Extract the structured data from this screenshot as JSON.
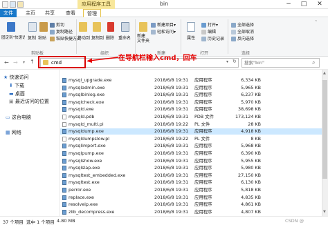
{
  "window": {
    "title": "bin",
    "contextual_tab": "应用程序工具",
    "controls": [
      "−",
      "□",
      "✕"
    ]
  },
  "tabs": [
    {
      "label": "文件"
    },
    {
      "label": "主页"
    },
    {
      "label": "共享"
    },
    {
      "label": "查看"
    },
    {
      "label": "管理"
    }
  ],
  "ribbon": {
    "clipboard": {
      "pin": "固定到\"快速访问\"",
      "copy": "复制",
      "paste": "粘贴",
      "cut": "剪切",
      "copy_path": "复制路径",
      "paste_shortcut": "粘贴快捷方式",
      "label": "剪贴板"
    },
    "organize": {
      "move_to": "移动到",
      "copy_to": "复制到",
      "delete": "删除",
      "rename": "重命名",
      "label": "组织"
    },
    "new": {
      "new_folder": "新建\n文件夹",
      "new_item": "新建项目▾",
      "easy_access": "轻松访问▾",
      "label": "新建"
    },
    "open": {
      "properties": "属性",
      "open": "打开▾",
      "edit": "编辑",
      "history": "历史记录",
      "label": "打开"
    },
    "select": {
      "select_all": "全部选择",
      "select_none": "全部取消",
      "invert": "反向选择",
      "label": "选择"
    }
  },
  "addressbar": {
    "value": "cmd",
    "search_placeholder": "搜索\"bin\"",
    "annotation": "在导航栏输入cmd，回车"
  },
  "navpane": {
    "items": [
      {
        "label": "快速访问",
        "icon": "star-icon"
      },
      {
        "label": "下载",
        "icon": "download-icon"
      },
      {
        "label": "桌面",
        "icon": "desktop-icon"
      },
      {
        "label": "最近访问的位置",
        "icon": "recent-icon"
      },
      {
        "label": "这台电脑",
        "icon": "computer-icon"
      },
      {
        "label": "网络",
        "icon": "network-icon"
      }
    ]
  },
  "files": [
    {
      "name": "mysql_upgrade.exe",
      "date": "2018/6/8 19:31",
      "type": "应用程序",
      "size": "6,334 KB",
      "kind": "exe"
    },
    {
      "name": "mysqladmin.exe",
      "date": "2018/6/8 19:31",
      "type": "应用程序",
      "size": "5,965 KB",
      "kind": "exe"
    },
    {
      "name": "mysqlbinlog.exe",
      "date": "2018/6/8 19:31",
      "type": "应用程序",
      "size": "6,237 KB",
      "kind": "exe"
    },
    {
      "name": "mysqlcheck.exe",
      "date": "2018/6/8 19:31",
      "type": "应用程序",
      "size": "5,970 KB",
      "kind": "exe"
    },
    {
      "name": "mysqld.exe",
      "date": "2018/6/8 19:31",
      "type": "应用程序",
      "size": "38,698 KB",
      "kind": "exe"
    },
    {
      "name": "mysqld.pdb",
      "date": "2018/6/8 19:31",
      "type": "PDB 文件",
      "size": "173,124 KB",
      "kind": "file"
    },
    {
      "name": "mysqld_multi.pl",
      "date": "2018/6/8 19:22",
      "type": "PL 文件",
      "size": "28 KB",
      "kind": "file"
    },
    {
      "name": "mysqldump.exe",
      "date": "2018/6/8 19:31",
      "type": "应用程序",
      "size": "4,918 KB",
      "kind": "exe",
      "selected": true
    },
    {
      "name": "mysqldumpslow.pl",
      "date": "2018/6/8 19:22",
      "type": "PL 文件",
      "size": "8 KB",
      "kind": "file"
    },
    {
      "name": "mysqlimport.exe",
      "date": "2018/6/8 19:31",
      "type": "应用程序",
      "size": "5,968 KB",
      "kind": "exe"
    },
    {
      "name": "mysqlpump.exe",
      "date": "2018/6/8 19:31",
      "type": "应用程序",
      "size": "6,390 KB",
      "kind": "exe"
    },
    {
      "name": "mysqlshow.exe",
      "date": "2018/6/8 19:31",
      "type": "应用程序",
      "size": "5,955 KB",
      "kind": "exe"
    },
    {
      "name": "mysqlslap.exe",
      "date": "2018/6/8 19:31",
      "type": "应用程序",
      "size": "5,980 KB",
      "kind": "exe"
    },
    {
      "name": "mysqltest_embedded.exe",
      "date": "2018/6/8 19:31",
      "type": "应用程序",
      "size": "27,150 KB",
      "kind": "exe"
    },
    {
      "name": "mysqltest.exe",
      "date": "2018/6/8 19:31",
      "type": "应用程序",
      "size": "6,130 KB",
      "kind": "exe"
    },
    {
      "name": "perror.exe",
      "date": "2018/6/8 19:31",
      "type": "应用程序",
      "size": "5,818 KB",
      "kind": "exe"
    },
    {
      "name": "replace.exe",
      "date": "2018/6/8 19:31",
      "type": "应用程序",
      "size": "4,835 KB",
      "kind": "exe"
    },
    {
      "name": "resolveip.exe",
      "date": "2018/6/8 19:31",
      "type": "应用程序",
      "size": "4,861 KB",
      "kind": "exe"
    },
    {
      "name": "zlib_decompress.exe",
      "date": "2018/6/8 19:31",
      "type": "应用程序",
      "size": "4,807 KB",
      "kind": "exe"
    }
  ],
  "status": {
    "count": "37 个项目",
    "selected": "选中 1 个项目",
    "size": "4.80 MB",
    "watermark": "CSDN @"
  },
  "colors": {
    "accent": "#1979ca",
    "annotation": "#e60000",
    "selection": "#cce8ff",
    "contextual": "#f8e79b"
  }
}
